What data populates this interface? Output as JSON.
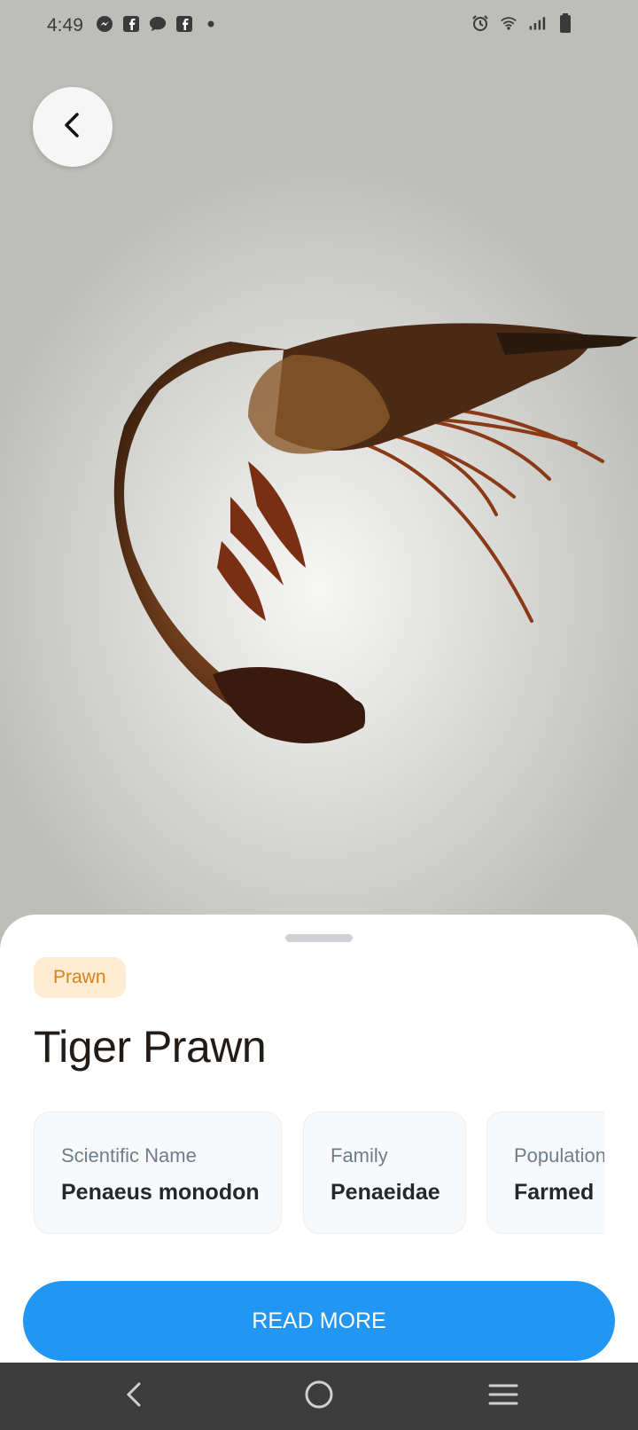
{
  "status_bar": {
    "time": "4:49",
    "left_icons": [
      "messenger-icon",
      "facebook-icon",
      "chat-bubble-icon",
      "facebook-icon",
      "dot-icon"
    ],
    "right_icons": [
      "alarm-icon",
      "wifi-icon",
      "signal-icon",
      "battery-icon"
    ]
  },
  "detail": {
    "category_badge": "Prawn",
    "title": "Tiger Prawn",
    "info_cards": [
      {
        "label": "Scientific Name",
        "value": "Penaeus monodon"
      },
      {
        "label": "Family",
        "value": "Penaeidae"
      },
      {
        "label": "Population",
        "value": "Farmed"
      }
    ],
    "read_more_label": "READ MORE"
  },
  "colors": {
    "accent": "#2196f3",
    "badge_bg": "#fdebd2",
    "badge_text": "#d9801a",
    "nav_bar": "#3d3d3d"
  },
  "nav_bar": {
    "buttons": [
      "back-icon",
      "home-icon",
      "recents-icon"
    ]
  }
}
